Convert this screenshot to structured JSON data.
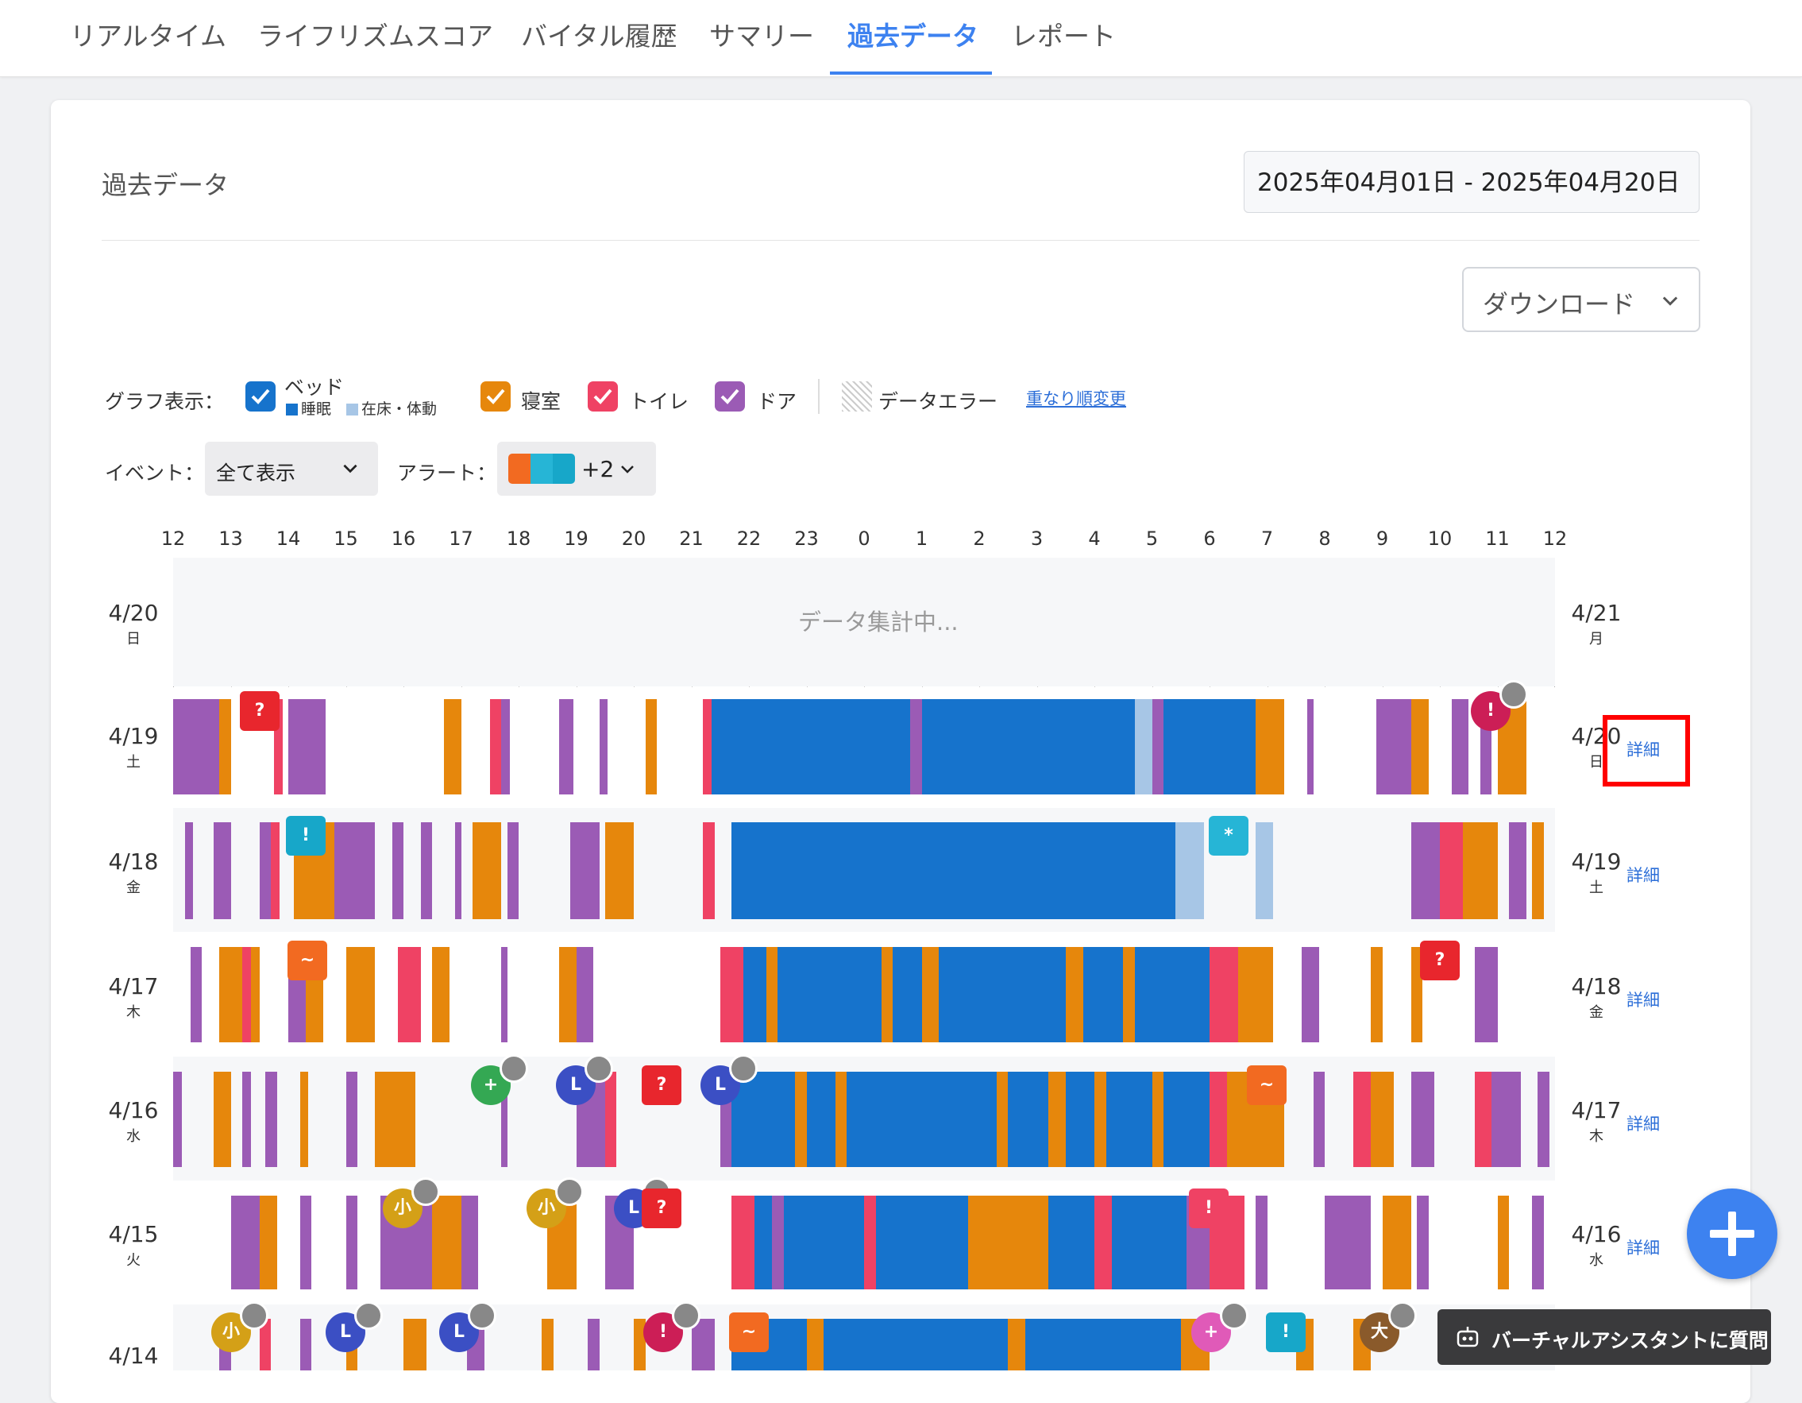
{
  "tabs": [
    {
      "label": "リアルタイム"
    },
    {
      "label": "ライフリズムスコア"
    },
    {
      "label": "バイタル履歴"
    },
    {
      "label": "サマリー"
    },
    {
      "label": "過去データ",
      "active": true
    },
    {
      "label": "レポート"
    }
  ],
  "header": {
    "title": "過去データ",
    "date_range": "2025年04月01日 - 2025年04月20日",
    "download_label": "ダウンロード"
  },
  "legend": {
    "label": "グラフ表示：",
    "bed": "ベッド",
    "sleep": "睡眠",
    "in_bed": "在床・体動",
    "bedroom": "寝室",
    "toilet": "トイレ",
    "door": "ドア",
    "data_error": "データエラー",
    "order_link": "重なり順変更"
  },
  "filters": {
    "event_label": "イベント：",
    "event_value": "全て表示",
    "alert_label": "アラート：",
    "alert_extra": "+2"
  },
  "hours": [
    "12",
    "13",
    "14",
    "15",
    "16",
    "17",
    "18",
    "19",
    "20",
    "21",
    "22",
    "23",
    "0",
    "1",
    "2",
    "3",
    "4",
    "5",
    "6",
    "7",
    "8",
    "9",
    "10",
    "11",
    "12"
  ],
  "aggregating_text": "データ集計中...",
  "detail_label": "詳細",
  "rows": [
    {
      "date": "4/20",
      "weekday": "日",
      "next_date": "4/21",
      "next_weekday": "月"
    },
    {
      "date": "4/19",
      "weekday": "土",
      "next_date": "4/20",
      "next_weekday": "日"
    },
    {
      "date": "4/18",
      "weekday": "金",
      "next_date": "4/19",
      "next_weekday": "土"
    },
    {
      "date": "4/17",
      "weekday": "木",
      "next_date": "4/18",
      "next_weekday": "金"
    },
    {
      "date": "4/16",
      "weekday": "水",
      "next_date": "4/17",
      "next_weekday": "木"
    },
    {
      "date": "4/15",
      "weekday": "火",
      "next_date": "4/16",
      "next_weekday": "水"
    },
    {
      "date": "4/14",
      "weekday": "",
      "next_date": "",
      "next_weekday": ""
    }
  ],
  "colors": {
    "sleep": "#1673cc",
    "in_bed": "#a7c6e6",
    "bedroom": "#e6870c",
    "toilet": "#ef4264",
    "door": "#9b5bb5",
    "accent": "#3d82f0"
  },
  "assistant_label": "バーチャルアシスタントに質問"
}
